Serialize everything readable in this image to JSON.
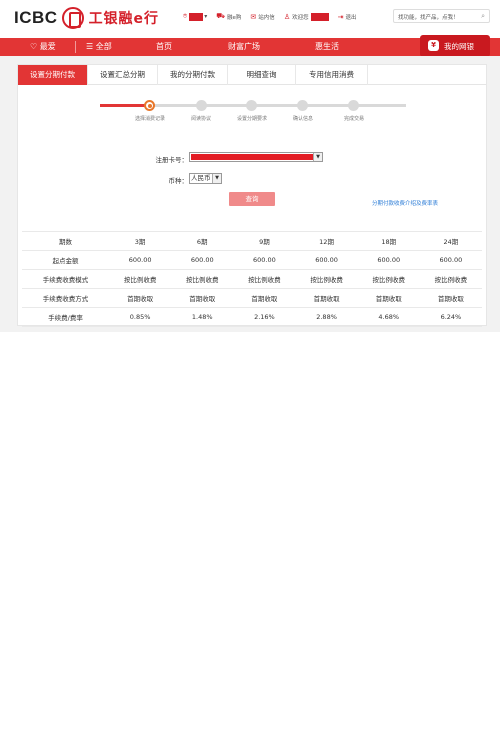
{
  "header": {
    "logo_text": "ICBC",
    "logo_cn": "工银融e行",
    "links": [
      {
        "icon": "location-pin-icon",
        "label": ""
      },
      {
        "icon": "cart-icon",
        "label": "融e购"
      },
      {
        "icon": "mail-icon",
        "label": "站内信"
      },
      {
        "icon": "user-icon",
        "label": "欢迎您"
      },
      {
        "icon": "logout-icon",
        "label": "退出"
      }
    ],
    "search_placeholder": "找功能，找产品，点我！",
    "accent_color": "#e23535"
  },
  "nav": {
    "favorites": "最爱",
    "all": "全部",
    "items": [
      "首页",
      "财富广场",
      "惠生活"
    ],
    "my_bank": "我的网银"
  },
  "tabs": [
    {
      "label": "设置分期付款",
      "active": true
    },
    {
      "label": "设置汇总分期",
      "active": false
    },
    {
      "label": "我的分期付款",
      "active": false
    },
    {
      "label": "明细查询",
      "active": false
    },
    {
      "label": "专用信用消费",
      "active": false
    }
  ],
  "steps": [
    {
      "label": "选择消费记录",
      "active": true
    },
    {
      "label": "阅读协议",
      "active": false
    },
    {
      "label": "设置分期要求",
      "active": false
    },
    {
      "label": "确认信息",
      "active": false
    },
    {
      "label": "完成交易",
      "active": false
    }
  ],
  "form": {
    "card_label": "注册卡号：",
    "currency_label": "币种：",
    "currency_value": "人民币",
    "query_button": "查询",
    "fee_link": "分期付款收费介绍及费率表"
  },
  "table": {
    "header": [
      "期数",
      "3期",
      "6期",
      "9期",
      "12期",
      "18期",
      "24期"
    ],
    "rows": [
      [
        "起点金额",
        "600.00",
        "600.00",
        "600.00",
        "600.00",
        "600.00",
        "600.00"
      ],
      [
        "手续费收费模式",
        "按比例收费",
        "按比例收费",
        "按比例收费",
        "按比例收费",
        "按比例收费",
        "按比例收费"
      ],
      [
        "手续费收费方式",
        "首期收取",
        "首期收取",
        "首期收取",
        "首期收取",
        "首期收取",
        "首期收取"
      ],
      [
        "手续费/费率",
        "0.85%",
        "1.48%",
        "2.16%",
        "2.88%",
        "4.68%",
        "6.24%"
      ]
    ]
  }
}
